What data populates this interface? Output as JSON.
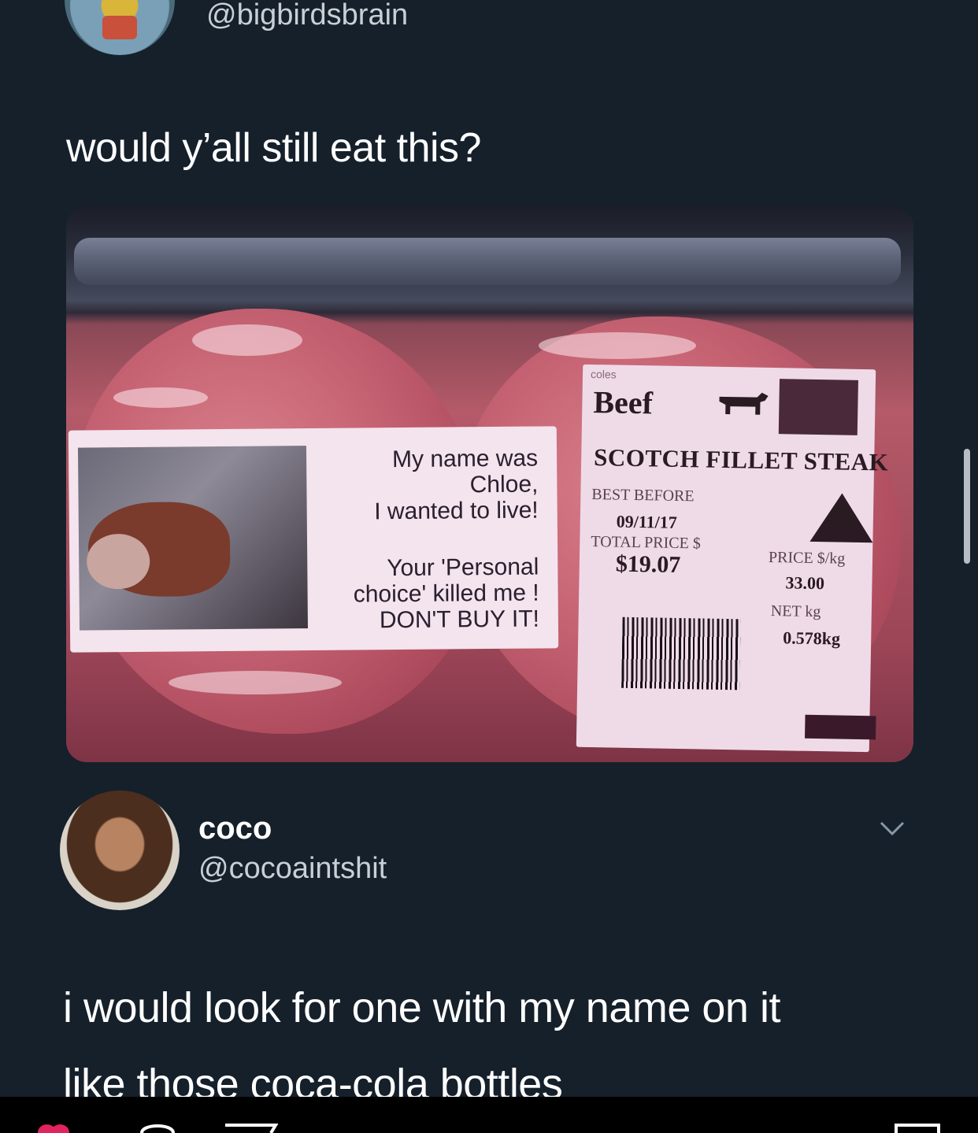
{
  "original_tweet": {
    "handle": "@bigbirdsbrain",
    "text": "would y’all still eat this?"
  },
  "photo": {
    "sticker": {
      "line1": "My name was",
      "line2": "Chloe,",
      "line3": "I wanted to live!",
      "line4": "Your 'Personal",
      "line5": "choice' killed me !",
      "line6": "DON'T BUY IT!"
    },
    "store_label": {
      "brand": "coles",
      "category": "Beef",
      "product": "SCOTCH FILLET STEAK",
      "best_before_label": "BEST BEFORE",
      "best_before_value": "09/11/17",
      "total_price_label": "TOTAL PRICE $",
      "total_price_value": "$19.07",
      "price_per_kg_label": "PRICE $/kg",
      "price_per_kg_value": "33.00",
      "net_kg_label": "NET kg",
      "net_kg_value": "0.578kg"
    }
  },
  "reply": {
    "name": "coco",
    "handle": "@cocoaintshit",
    "line1": "i would look for one with my name on it",
    "line2": "like those coca-cola bottles"
  },
  "colors": {
    "background": "#15202b",
    "text_primary": "#ffffff",
    "text_secondary": "#c8d0d6"
  }
}
